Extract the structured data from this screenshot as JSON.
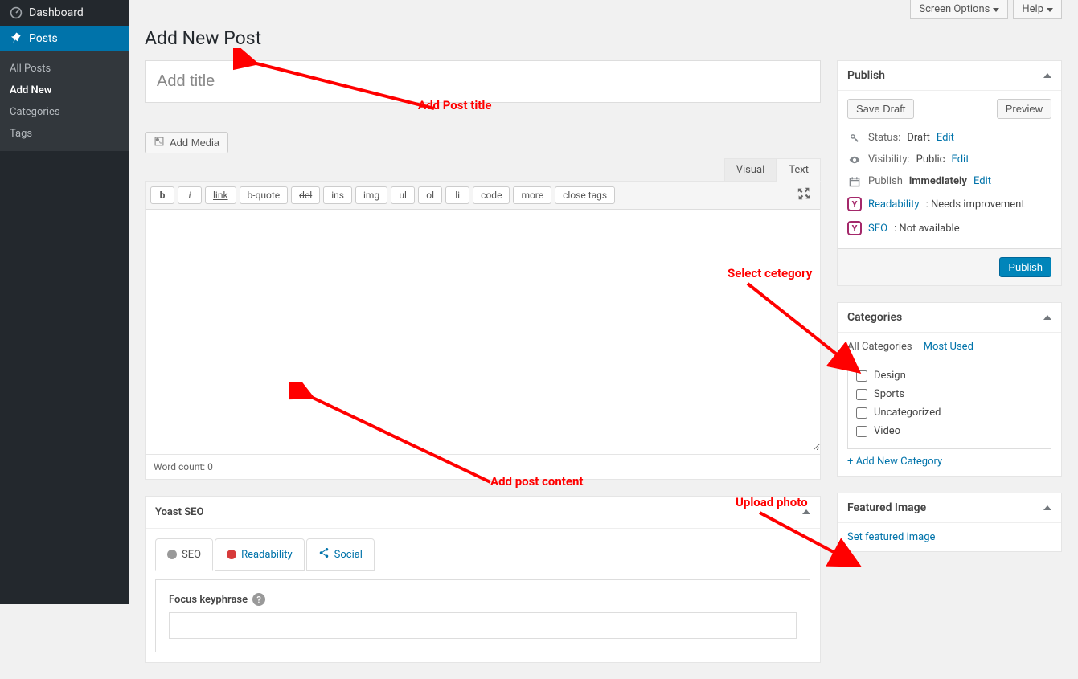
{
  "topbar": {
    "screen_options": "Screen Options",
    "help": "Help"
  },
  "sidebar": {
    "dashboard": "Dashboard",
    "posts": "Posts",
    "subs": {
      "all": "All Posts",
      "add": "Add New",
      "cat": "Categories",
      "tags": "Tags"
    }
  },
  "page_title": "Add New Post",
  "title_placeholder": "Add title",
  "add_media": "Add Media",
  "editor": {
    "tab_visual": "Visual",
    "tab_text": "Text",
    "buttons": {
      "b": "b",
      "i": "i",
      "link": "link",
      "bquote": "b-quote",
      "del": "del",
      "ins": "ins",
      "img": "img",
      "ul": "ul",
      "ol": "ol",
      "li": "li",
      "code": "code",
      "more": "more",
      "close": "close tags"
    },
    "wordcount": "Word count: 0"
  },
  "yoast": {
    "title": "Yoast SEO",
    "tabs": {
      "seo": "SEO",
      "read": "Readability",
      "social": "Social"
    },
    "focus_label": "Focus keyphrase"
  },
  "publish": {
    "title": "Publish",
    "save_draft": "Save Draft",
    "preview": "Preview",
    "status_lbl": "Status:",
    "status_val": "Draft",
    "edit": "Edit",
    "vis_lbl": "Visibility:",
    "vis_val": "Public",
    "pub_lbl": "Publish",
    "pub_val": "immediately",
    "read_lbl": "Readability",
    "read_val": ": Needs improvement",
    "seo_lbl": "SEO",
    "seo_val": ": Not available",
    "publish_btn": "Publish"
  },
  "categories": {
    "title": "Categories",
    "tab_all": "All Categories",
    "tab_most": "Most Used",
    "items": [
      "Design",
      "Sports",
      "Uncategorized",
      "Video"
    ],
    "add_new": "+ Add New Category"
  },
  "featured": {
    "title": "Featured Image",
    "set": "Set featured image"
  },
  "anno": {
    "title": "Add Post title",
    "content": "Add post content",
    "category": "Select cetegory",
    "photo": "Upload photo"
  }
}
